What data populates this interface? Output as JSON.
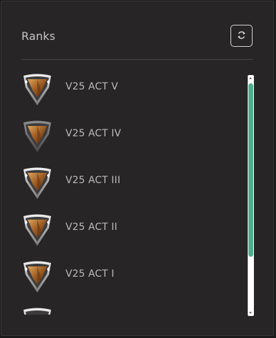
{
  "panel": {
    "title": "Ranks",
    "refresh_icon": "refresh-icon"
  },
  "ranks": [
    {
      "label": "V25 ACT V",
      "icon": "rank-badge-icon"
    },
    {
      "label": "V25 ACT IV",
      "icon": "rank-badge-icon"
    },
    {
      "label": "V25 ACT III",
      "icon": "rank-badge-icon"
    },
    {
      "label": "V25 ACT II",
      "icon": "rank-badge-icon"
    },
    {
      "label": "V25 ACT I",
      "icon": "rank-badge-icon"
    },
    {
      "label": "",
      "icon": "rank-badge-icon"
    }
  ],
  "colors": {
    "background": "#272526",
    "accent_scroll": "#4fae8d",
    "text": "#bdbdbd"
  }
}
